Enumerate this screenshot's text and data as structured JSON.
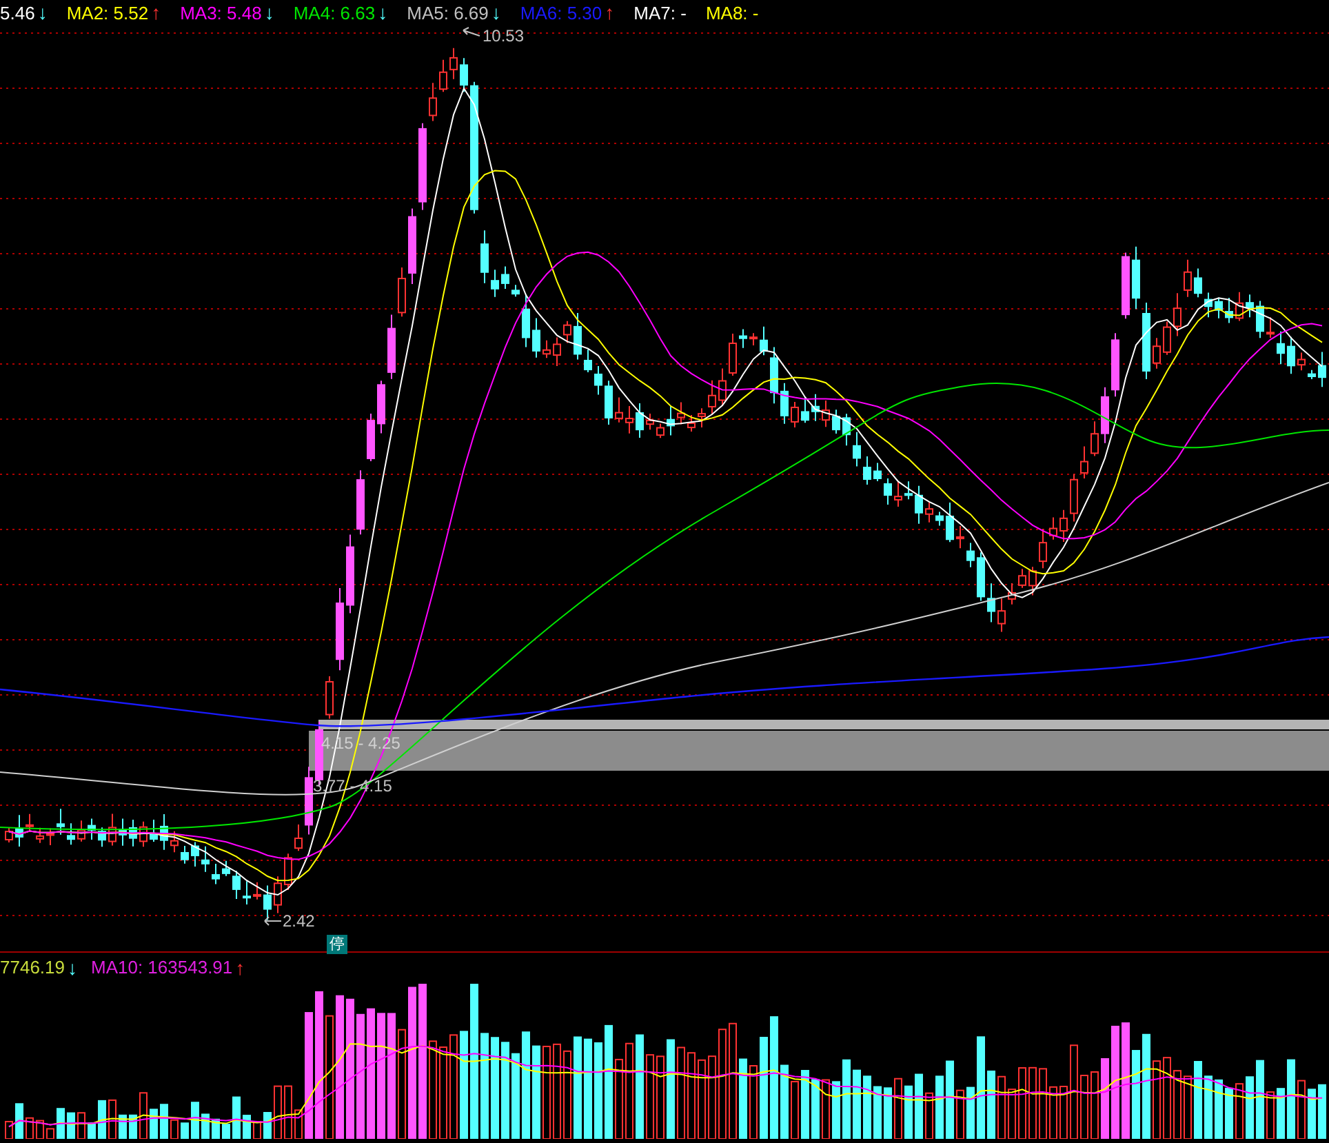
{
  "price_legend": [
    {
      "label": "5.46",
      "color": "#ffffff",
      "arrow": "↓",
      "kind": "fall"
    },
    {
      "label": "MA2: 5.52",
      "color": "#ffff00",
      "arrow": "↑",
      "kind": "rise"
    },
    {
      "label": "MA3: 5.48",
      "color": "#ff00ff",
      "arrow": "↓",
      "kind": "fall"
    },
    {
      "label": "MA4: 6.63",
      "color": "#00e600",
      "arrow": "↓",
      "kind": "fall"
    },
    {
      "label": "MA5: 6.69",
      "color": "#c0c0c0",
      "arrow": "↓",
      "kind": "fall"
    },
    {
      "label": "MA6: 5.30",
      "color": "#1a1aff",
      "arrow": "↑",
      "kind": "rise"
    },
    {
      "label": "MA7: -",
      "color": "#ffffff"
    },
    {
      "label": "MA8: -",
      "color": "#ffff00"
    }
  ],
  "high_label": "10.53",
  "low_label": "2.42",
  "zone_label": "4.15 - 4.25",
  "support_label": "3.77 - 4.15",
  "halt_badge": "停",
  "volume_legend": [
    {
      "label": "7746.19",
      "color": "#c8dc3c",
      "arrow": "↓",
      "kind": "fall"
    },
    {
      "label": "MA10: 163543.91",
      "color": "#e020e0",
      "arrow": "↑",
      "kind": "rise"
    }
  ]
}
